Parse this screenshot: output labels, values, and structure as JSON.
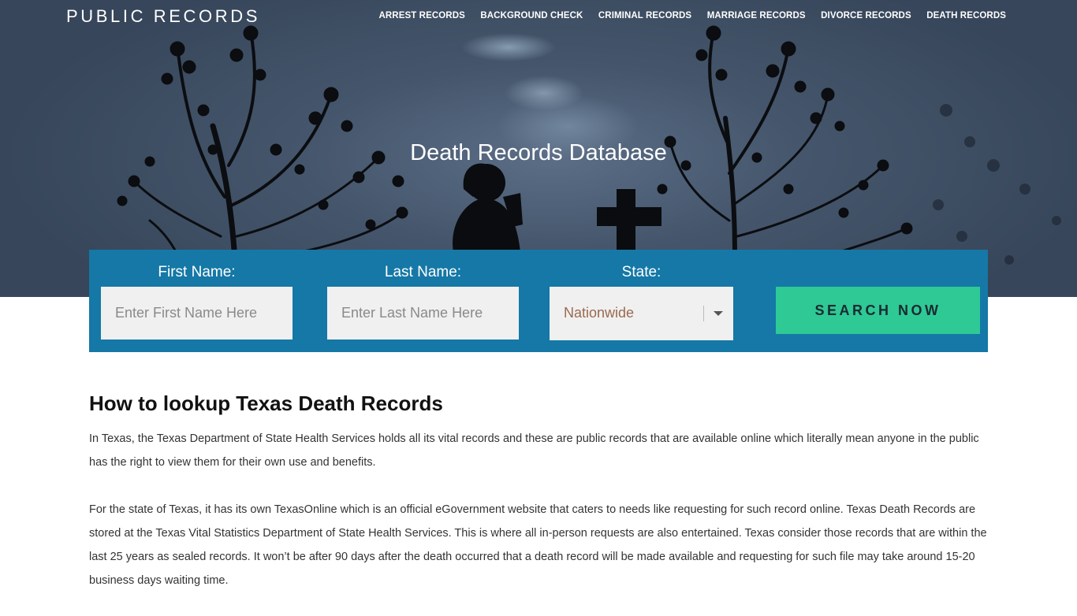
{
  "header": {
    "logo": "PUBLIC RECORDS",
    "nav": [
      "ARREST RECORDS",
      "BACKGROUND CHECK",
      "CRIMINAL RECORDS",
      "MARRIAGE RECORDS",
      "DIVORCE RECORDS",
      "DEATH RECORDS"
    ]
  },
  "hero": {
    "title": "Death Records Database"
  },
  "search": {
    "first_label": "First Name:",
    "first_placeholder": "Enter First Name Here",
    "last_label": "Last Name:",
    "last_placeholder": "Enter Last Name Here",
    "state_label": "State:",
    "state_value": "Nationwide",
    "button": "SEARCH NOW"
  },
  "article": {
    "heading": "How to lookup Texas Death Records",
    "paragraphs": [
      "In Texas, the Texas Department of State Health Services holds all its vital records and these are public records that are available online which literally mean anyone in the public has the right to view them for their own use and benefits.",
      "For the state of Texas, it has its own TexasOnline which is an official eGovernment website that caters to needs like requesting for such record online. Texas Death Records are stored at the Texas Vital Statistics Department of State Health Services. This is where all in-person requests are also entertained. Texas consider those records that are within the last 25 years as sealed records. It won’t be after 90 days after the death occurred that a death record will be made available and requesting for such file may take around 15-20 business days waiting time."
    ]
  },
  "colors": {
    "panel": "#1578a6",
    "button": "#2ec995"
  }
}
